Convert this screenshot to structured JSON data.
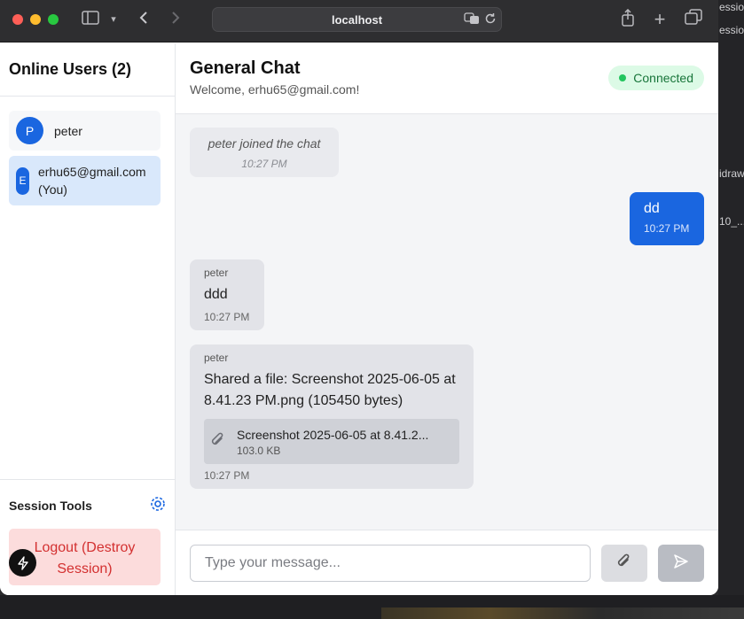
{
  "browser": {
    "url": "localhost"
  },
  "desktop_fragments": [
    "essio",
    "essio",
    "idraw",
    "10_..."
  ],
  "sidebar": {
    "title": "Online Users (2)",
    "users": [
      {
        "initial": "P",
        "name": "peter"
      },
      {
        "initial": "E",
        "name": "erhu65@gmail.com",
        "suffix": "(You)"
      }
    ],
    "tools_title": "Session Tools",
    "logout_label": "Logout (Destroy Session)"
  },
  "chat": {
    "title": "General Chat",
    "subtitle": "Welcome, erhu65@gmail.com!",
    "status": "Connected",
    "messages": [
      {
        "type": "system",
        "text": "peter joined the chat",
        "time": "10:27 PM"
      },
      {
        "type": "mine",
        "text": "dd",
        "time": "10:27 PM"
      },
      {
        "type": "theirs",
        "sender": "peter",
        "text": "ddd",
        "time": "10:27 PM"
      },
      {
        "type": "theirs",
        "sender": "peter",
        "text": "Shared a file: Screenshot 2025-06-05 at 8.41.23 PM.png (105450 bytes)",
        "file_name": "Screenshot 2025-06-05 at 8.41.2...",
        "file_size": "103.0 KB",
        "time": "10:27 PM"
      }
    ],
    "input_placeholder": "Type your message..."
  },
  "colors": {
    "accent": "#1a66e0",
    "connected": "#22c55e",
    "logout_bg": "#fcdcdc",
    "logout_text": "#d33030"
  },
  "icons": {
    "sidebar_toggle": "sidebar-icon",
    "back": "chevron-left-icon",
    "forward": "chevron-right-icon",
    "translate": "translate-icon",
    "reload": "reload-icon",
    "share": "share-icon",
    "new_tab": "plus-icon",
    "tabs": "tabs-icon",
    "gear": "gear-icon",
    "bolt": "bolt-icon",
    "attach": "paperclip-icon",
    "send": "send-icon"
  }
}
